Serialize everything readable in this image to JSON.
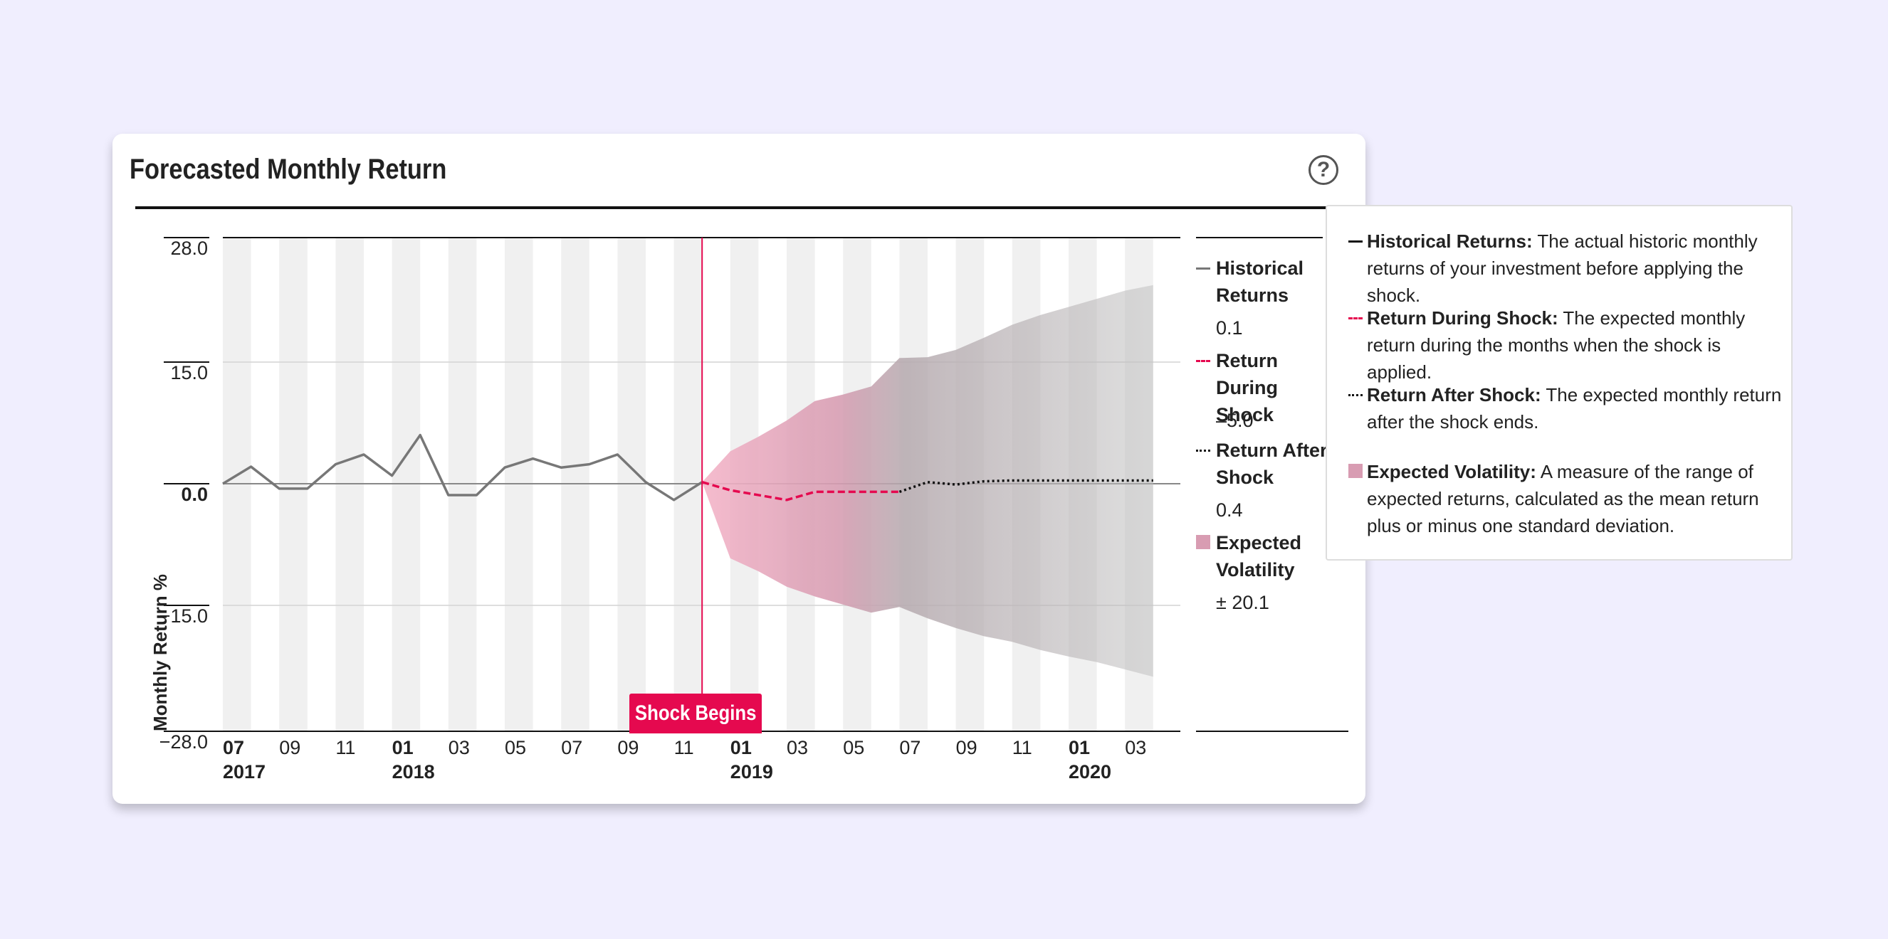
{
  "card": {
    "title": "Forecasted Monthly Return",
    "help_glyph": "?"
  },
  "chart_data": {
    "type": "line",
    "title": "Forecasted Monthly Return",
    "ylabel": "Monthly Return %",
    "ylim": [
      -28.0,
      28.0
    ],
    "y_ticks": [
      "28.0",
      "15.0",
      "0.0",
      "−15.0",
      "−28.0"
    ],
    "y_tick_values": [
      28,
      15,
      0,
      -15,
      -28
    ],
    "x_ticks": [
      {
        "month": "07",
        "year": "2017"
      },
      {
        "month": "09",
        "year": ""
      },
      {
        "month": "11",
        "year": ""
      },
      {
        "month": "01",
        "year": "2018"
      },
      {
        "month": "03",
        "year": ""
      },
      {
        "month": "05",
        "year": ""
      },
      {
        "month": "07",
        "year": ""
      },
      {
        "month": "09",
        "year": ""
      },
      {
        "month": "11",
        "year": ""
      },
      {
        "month": "01",
        "year": "2019"
      },
      {
        "month": "03",
        "year": ""
      },
      {
        "month": "05",
        "year": ""
      },
      {
        "month": "07",
        "year": ""
      },
      {
        "month": "09",
        "year": ""
      },
      {
        "month": "11",
        "year": ""
      },
      {
        "month": "01",
        "year": "2020"
      },
      {
        "month": "03",
        "year": ""
      }
    ],
    "x_start": "2017-07",
    "x_end": "2020-04",
    "shock_start": "2018-12",
    "shock_label": "Shock Begins",
    "series": [
      {
        "name": "Historical Returns",
        "style": "solid",
        "color": "#777777",
        "x": [
          "2017-07",
          "2017-08",
          "2017-09",
          "2017-10",
          "2017-11",
          "2017-12",
          "2018-01",
          "2018-02",
          "2018-03",
          "2018-04",
          "2018-05",
          "2018-06",
          "2018-07",
          "2018-08",
          "2018-09",
          "2018-10",
          "2018-11",
          "2018-12"
        ],
        "values": [
          0.0,
          2.1,
          -0.6,
          -0.6,
          2.4,
          3.6,
          1.0,
          6.0,
          -1.4,
          -1.4,
          2.0,
          3.1,
          2.0,
          2.4,
          3.6,
          0.2,
          -2.0,
          0.2
        ]
      },
      {
        "name": "Return During Shock",
        "style": "dashed",
        "color": "#e5094f",
        "x": [
          "2018-12",
          "2019-01",
          "2019-02",
          "2019-03",
          "2019-04",
          "2019-05",
          "2019-06",
          "2019-07"
        ],
        "values": [
          0.2,
          -0.8,
          -1.4,
          -2.0,
          -1.0,
          -1.0,
          -1.0,
          -1.0
        ]
      },
      {
        "name": "Return After Shock",
        "style": "dotted",
        "color": "#111111",
        "x": [
          "2019-07",
          "2019-08",
          "2019-09",
          "2019-10",
          "2019-11",
          "2019-12",
          "2020-01",
          "2020-02",
          "2020-03",
          "2020-04"
        ],
        "values": [
          -1.0,
          0.2,
          -0.1,
          0.3,
          0.4,
          0.4,
          0.4,
          0.4,
          0.4,
          0.4
        ]
      }
    ],
    "volatility_band": {
      "name": "Expected Volatility",
      "color_shock": "#f0a8c0",
      "color_after": "#aaaaaa",
      "x": [
        "2018-12",
        "2019-01",
        "2019-02",
        "2019-03",
        "2019-04",
        "2019-05",
        "2019-06",
        "2019-07",
        "2019-08",
        "2019-09",
        "2019-10",
        "2019-11",
        "2019-12",
        "2020-01",
        "2020-02",
        "2020-03",
        "2020-04"
      ],
      "upper": [
        0.2,
        4.0,
        5.8,
        7.8,
        10.2,
        11.0,
        12.0,
        15.5,
        15.6,
        16.5,
        18.0,
        19.6,
        20.8,
        21.8,
        22.8,
        23.8,
        24.5
      ],
      "lower": [
        0.2,
        -9.2,
        -10.8,
        -12.7,
        -13.9,
        -14.9,
        -15.9,
        -15.2,
        -16.6,
        -17.8,
        -18.8,
        -19.5,
        -20.5,
        -21.3,
        -22.0,
        -22.9,
        -23.8
      ]
    },
    "legend": [
      {
        "name": "Historical Returns",
        "value": "0.1",
        "style": "solid",
        "color": "#777777"
      },
      {
        "name": "Return During Shock",
        "value": "–5.0",
        "style": "dashed",
        "color": "#e5094f"
      },
      {
        "name": "Return After Shock",
        "value": "0.4",
        "style": "dotted",
        "color": "#111111"
      },
      {
        "name": "Expected Volatility",
        "value": "± 20.1",
        "style": "box",
        "color": "#d89cb2"
      }
    ],
    "legend_position": "right",
    "grid": true
  },
  "tooltip": {
    "items": [
      {
        "term": "Historical Returns:",
        "text": " The actual historic monthly returns of your investment before applying the shock.",
        "style": "solid",
        "color": "#111111"
      },
      {
        "term": "Return During Shock:",
        "text": " The expected monthly return during the months when the shock is applied.",
        "style": "dashed",
        "color": "#e5094f"
      },
      {
        "term": "Return After Shock:",
        "text": " The expected monthly return after the shock ends.",
        "style": "dotted",
        "color": "#111111"
      },
      {
        "term": "Expected Volatility:",
        "text": " A measure of the range of expected returns, calculated as the mean return plus or minus one standard deviation.",
        "style": "box",
        "color": "#d89cb2"
      }
    ]
  }
}
